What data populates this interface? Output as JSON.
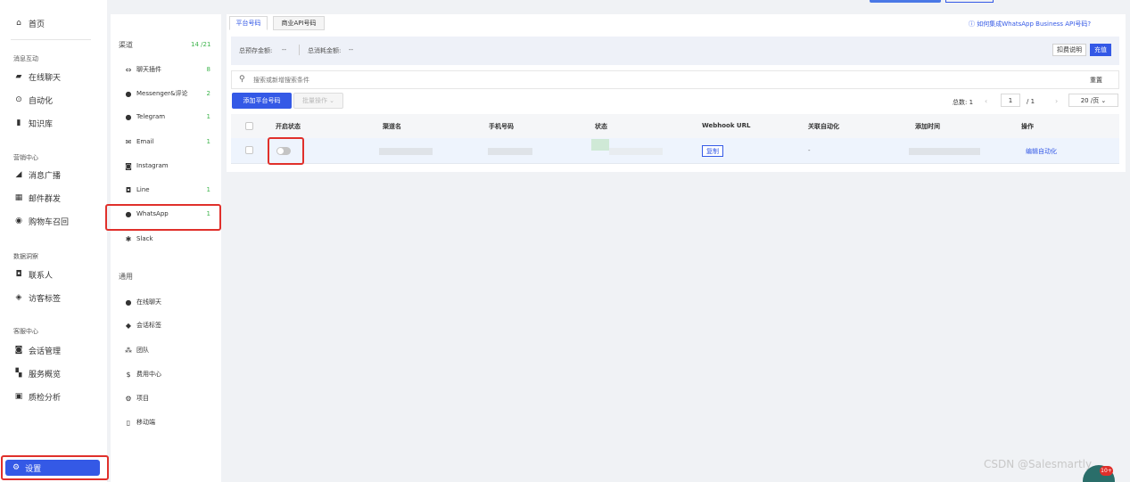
{
  "sidebar": {
    "home": "首页",
    "groups": {
      "messages": "消息互动",
      "marketing": "营销中心",
      "data": "数据洞察",
      "service": "客服中心"
    },
    "items": {
      "live_chat": "在线聊天",
      "automation": "自动化",
      "knowledge": "知识库",
      "broadcast": "消息广播",
      "mail": "邮件群发",
      "cart": "购物车召回",
      "contacts": "联系人",
      "tags": "访客标签",
      "sessions": "会话管理",
      "overview": "服务概览",
      "quality": "质检分析"
    },
    "settings": "设置"
  },
  "channels": {
    "title": "渠道",
    "count": "14 /21",
    "items": [
      {
        "label": "聊天插件",
        "count": "8",
        "icon": "chat-plugin-icon"
      },
      {
        "label": "Messenger&评论",
        "count": "2",
        "icon": "messenger-icon"
      },
      {
        "label": "Telegram",
        "count": "1",
        "icon": "telegram-icon"
      },
      {
        "label": "Email",
        "count": "1",
        "icon": "email-icon"
      },
      {
        "label": "Instagram",
        "count": "",
        "icon": "instagram-icon"
      },
      {
        "label": "Line",
        "count": "1",
        "icon": "line-icon"
      },
      {
        "label": "WhatsApp",
        "count": "1",
        "icon": "whatsapp-icon"
      },
      {
        "label": "Slack",
        "count": "",
        "icon": "slack-icon"
      }
    ],
    "general_title": "通用",
    "general": [
      {
        "label": "在线聊天",
        "icon": "chat-icon"
      },
      {
        "label": "会话标签",
        "icon": "tag-icon"
      },
      {
        "label": "团队",
        "icon": "team-icon"
      },
      {
        "label": "费用中心",
        "icon": "dollar-icon"
      },
      {
        "label": "项目",
        "icon": "project-icon"
      },
      {
        "label": "移动端",
        "icon": "mobile-icon"
      }
    ]
  },
  "main": {
    "tabs": [
      "平台号码",
      "商业API号码"
    ],
    "help_link": "如何集成WhatsApp Business API号码?",
    "balance_label": "总预存金额:",
    "balance_value": "--",
    "consumed_label": "总消耗金额:",
    "consumed_value": "--",
    "deduct_btn": "扣费说明",
    "recharge_btn": "充值",
    "search_placeholder": "搜索或新增搜索条件",
    "reset": "重置",
    "add_btn": "添加平台号码",
    "batch_btn": "批量操作",
    "total_label": "总数: 1",
    "page_current": "1",
    "page_total": "/ 1",
    "page_size": "20 /页",
    "columns": [
      "开启状态",
      "渠道名",
      "手机号码",
      "状态",
      "Webhook URL",
      "关联自动化",
      "添加时间",
      "操作"
    ],
    "row": {
      "webhook": "复制",
      "automation": "-",
      "action": "编辑自动化",
      "toggle_on": false
    }
  },
  "watermark": "CSDN @Salesmartly",
  "badge": "10+"
}
